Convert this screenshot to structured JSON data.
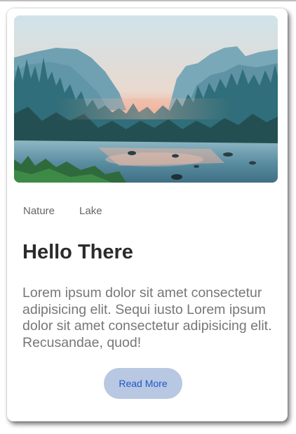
{
  "card": {
    "image_alt": "mountain-lake-landscape",
    "tags": [
      "Nature",
      "Lake"
    ],
    "title": "Hello There",
    "description": "Lorem ipsum dolor sit amet consectetur adipisicing elit. Sequi iusto Lorem ipsum dolor sit amet consectetur adipisicing elit. Recusandae, quod!",
    "button_label": "Read More"
  },
  "colors": {
    "title": "#2b2b2b",
    "text": "#777777",
    "button_bg": "#b8c8e2",
    "button_text": "#1e56c8"
  }
}
